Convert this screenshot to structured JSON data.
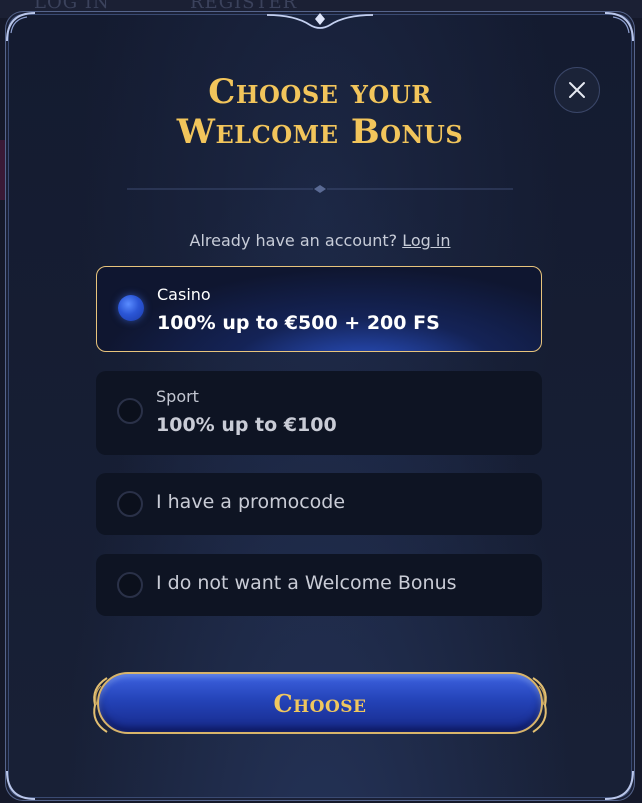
{
  "background": {
    "topbar_text": [
      "LOG IN",
      "REGISTER"
    ]
  },
  "modal": {
    "title_line1": "Choose your",
    "title_line2": "Welcome Bonus",
    "account_prompt": "Already have an account?",
    "login_link": "Log in",
    "close_icon": "close-icon",
    "options": [
      {
        "label": "Casino",
        "value": "100% up to €500 + 200 FS",
        "selected": true
      },
      {
        "label": "Sport",
        "value": "100% up to €100",
        "selected": false
      },
      {
        "label": "I have a promocode",
        "selected": false
      },
      {
        "label": "I do not want a Welcome Bonus",
        "selected": false
      }
    ],
    "choose_button": "Choose"
  },
  "colors": {
    "gold": "#f2c55b",
    "accent_blue": "#2b56d6",
    "selected_border": "#e8c47c",
    "panel": "#141b30"
  }
}
